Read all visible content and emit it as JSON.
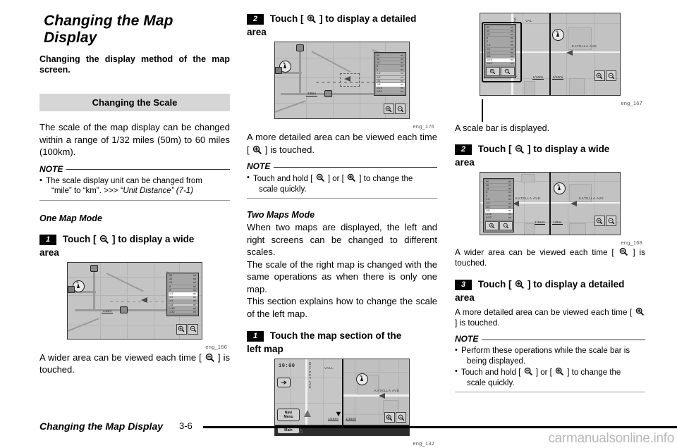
{
  "document": {
    "chapter_title": "Changing the Map Display",
    "intro": "Changing the display method of the map screen.",
    "section_band": "Changing the Scale"
  },
  "left_column": {
    "scale_paragraph": "The scale of the map display can be changed within a range of 1/32 miles (50m) to 60 miles (100km).",
    "note_label": "NOTE",
    "note_items": [
      {
        "line1": "The scale display unit can be changed from",
        "line2": "“mile” to “km”.",
        "ref_arrow": ">>>",
        "ref_text": "“Unit Distance” (7-1)"
      }
    ],
    "sub_head": "One Map Mode",
    "step": {
      "num": "1",
      "text_before": "Touch [",
      "icon": "zoom-out-icon",
      "text_after": "] to display a wide",
      "continuation": "area"
    },
    "figure_caption": "eng_166",
    "after_text_before": "A wider area can be viewed each time [",
    "after_icon": "zoom-out-icon",
    "after_text_after": "] is touched."
  },
  "middle_column": {
    "step": {
      "num": "2",
      "text_before": "Touch [",
      "icon": "zoom-in-icon",
      "text_after": "] to display a detailed",
      "continuation": "area"
    },
    "figure_caption": "eng_176",
    "after_text_before": "A more detailed area can be viewed each time [",
    "after_icon": "zoom-in-icon",
    "after_text_after": "] is touched.",
    "note_label": "NOTE",
    "note_item": {
      "t1": "Touch and hold [",
      "i1": "zoom-out-icon",
      "t2": "] or [",
      "i2": "zoom-in-icon",
      "t3": "] to change the",
      "line2": "scale quickly."
    },
    "sub_head": "Two Maps Mode",
    "paragraphs": [
      "When two maps are displayed, the left and right screens can be changed to different scales.",
      "The scale of the right map is changed with the same operations as when there is only one map.",
      "This section explains how to change the scale of the left map."
    ],
    "step2": {
      "num": "1",
      "text": "Touch the map section of the",
      "continuation": "left map"
    },
    "figure_caption2": "eng_132"
  },
  "right_column": {
    "figure_caption": "eng_167",
    "callout_caption": "A scale bar is displayed.",
    "step_wide": {
      "num": "2",
      "text_before": "Touch [",
      "icon": "zoom-out-icon",
      "text_after": "] to display a wide",
      "continuation": "area"
    },
    "figure_caption2": "eng_168",
    "after_text_before": "A wider area can be viewed each time [",
    "after_icon": "zoom-out-icon",
    "after_text_after": "] is touched.",
    "step_detail": {
      "num": "3",
      "text_before": "Touch [",
      "icon": "zoom-in-icon",
      "text_after": "] to display a detailed",
      "continuation": "area"
    },
    "after2_text_before": "A more detailed area can be viewed each time [",
    "after2_icon": "zoom-in-icon",
    "after2_text_after": "] is touched.",
    "note_label": "NOTE",
    "note_item1": {
      "line1": "Perform these operations while the scale bar is",
      "line2": "being displayed."
    },
    "note_item2": {
      "t1": "Touch and hold [",
      "i1": "zoom-out-icon",
      "t2": "] or [",
      "i2": "zoom-in-icon",
      "t3": "] to change the",
      "line2": "scale quickly."
    }
  },
  "nav_screens": {
    "scale_values": [
      "60",
      "30",
      "15",
      "8",
      "3",
      "1.5",
      "1/2",
      "1/4",
      "1/8",
      "1/16",
      "1/32"
    ],
    "scale_unit": "mi",
    "eng166": {
      "selected": "1.5",
      "map_scale": "1.5mi"
    },
    "eng176": {
      "selected": "1/8",
      "map_scale": "1/8mi"
    },
    "eng132": {
      "clock": "10:00",
      "menu_button_line1": "Navi",
      "menu_button_line2": "Menu",
      "main_button": "Main",
      "left_scale": "1/16mi",
      "right_scale": "1/16mi"
    },
    "eng167": {
      "selected": "1/16",
      "left_scale": "1/10mi",
      "right_scale": "1/10mi",
      "street_1": "KATELLA AVE",
      "street_2": "VAL"
    },
    "eng168": {
      "selected": "1/8",
      "left_scale": "1/16mi",
      "right_scale": "1/8mi",
      "street_1": "KATELLA AVE",
      "street_2": "KATELLA AVE"
    },
    "street_vertical": "WALNUT AVE",
    "street_katella": "KATELLA AVE",
    "street_vall": "VALL"
  },
  "footer": {
    "title": "Changing the Map Display",
    "page": "3-6",
    "down_arrow": "▼",
    "watermark": "carmanualsonline.info"
  },
  "colors": {
    "band_bg": "#d6d6d6",
    "screen_bg": "#c9c9c9",
    "ink": "#000000"
  }
}
